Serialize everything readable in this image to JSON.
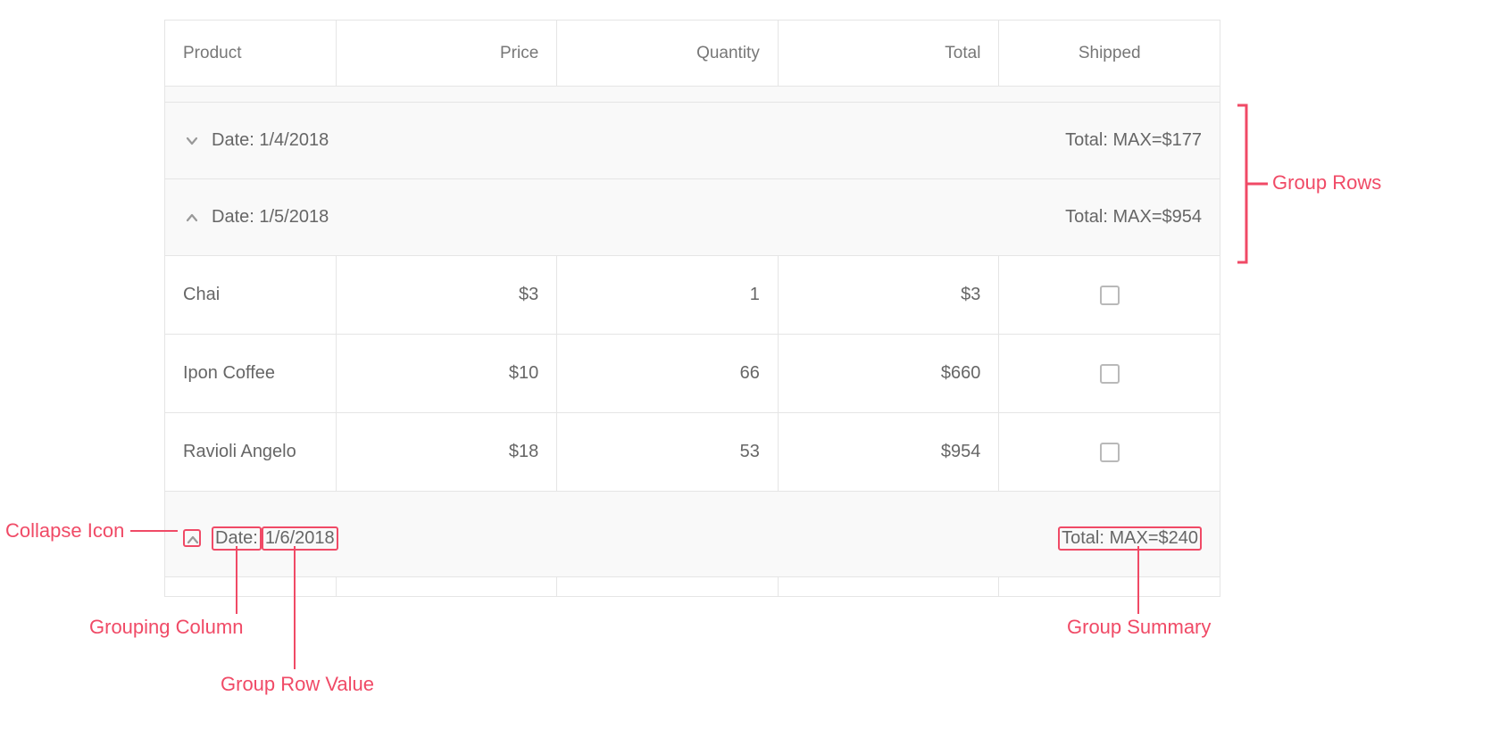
{
  "columns": [
    "Product",
    "Price",
    "Quantity",
    "Total",
    "Shipped"
  ],
  "groups": [
    {
      "prefix": "Date:",
      "value": "1/4/2018",
      "summary": "Total: MAX=$177",
      "collapsed": true
    },
    {
      "prefix": "Date:",
      "value": "1/5/2018",
      "summary": "Total: MAX=$954",
      "collapsed": false
    },
    {
      "prefix": "Date:",
      "value": "1/6/2018",
      "summary": "Total: MAX=$240",
      "collapsed": false
    }
  ],
  "rows": [
    {
      "product": "Chai",
      "price": "$3",
      "qty": "1",
      "total": "$3",
      "shipped": false
    },
    {
      "product": "Ipon Coffee",
      "price": "$10",
      "qty": "66",
      "total": "$660",
      "shipped": false
    },
    {
      "product": "Ravioli Angelo",
      "price": "$18",
      "qty": "53",
      "total": "$954",
      "shipped": false
    }
  ],
  "annotations": {
    "group_rows": "Group Rows",
    "collapse_icon": "Collapse Icon",
    "grouping_column": "Grouping Column",
    "group_row_value": "Group Row Value",
    "group_summary": "Group Summary"
  }
}
